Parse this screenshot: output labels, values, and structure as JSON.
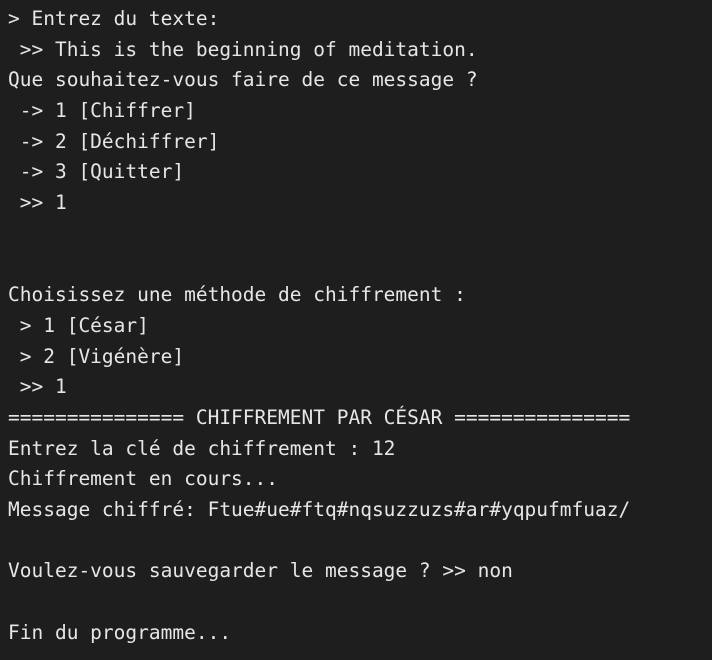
{
  "terminal": {
    "lines": [
      "> Entrez du texte:",
      " >> This is the beginning of meditation.",
      "Que souhaitez-vous faire de ce message ?",
      " -> 1 [Chiffrer]",
      " -> 2 [Déchiffrer]",
      " -> 3 [Quitter]",
      " >> 1",
      "",
      "",
      "Choisissez une méthode de chiffrement :",
      " > 1 [César]",
      " > 2 [Vigénère]",
      " >> 1",
      "=============== CHIFFREMENT PAR CÉSAR ===============",
      "Entrez la clé de chiffrement : 12",
      "Chiffrement en cours...",
      "Message chiffré: Ftue#ue#ftq#nqsuzzuzs#ar#yqpufmfuaz/",
      "",
      "Voulez-vous sauvegarder le message ? >> non",
      "",
      "Fin du programme..."
    ]
  }
}
